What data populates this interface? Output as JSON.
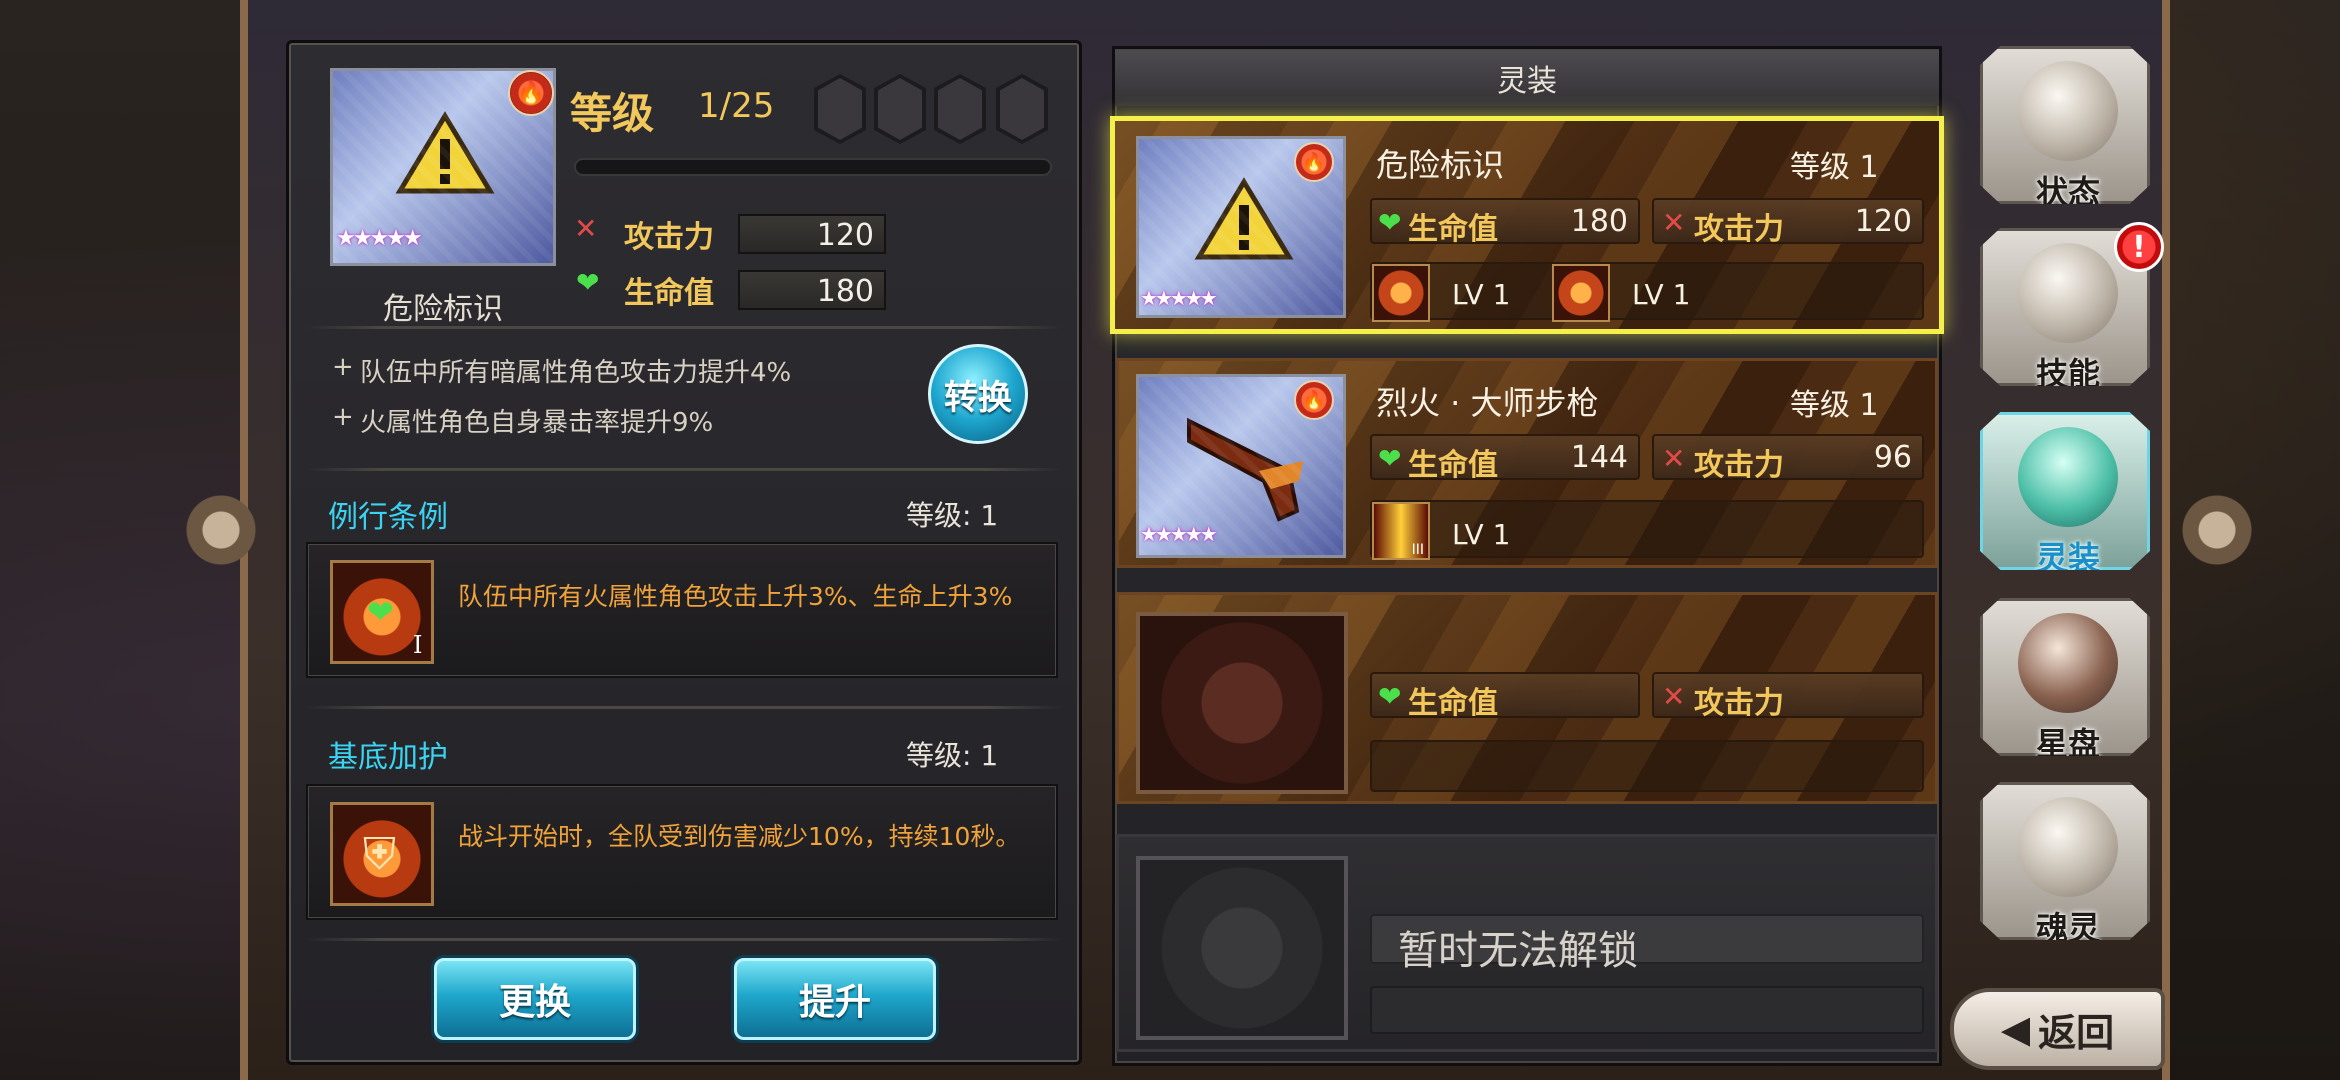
{
  "equipment": {
    "name": "危险标识",
    "level_label": "等级",
    "level_value": "1/25",
    "stats": [
      {
        "label": "攻击力",
        "value": "120",
        "icon": "crossed-swords-icon"
      },
      {
        "label": "生命值",
        "value": "180",
        "icon": "heart-icon"
      }
    ],
    "bonuses": [
      "队伍中所有暗属性角色攻击力提升4%",
      "火属性角色自身暴击率提升9%"
    ],
    "convert_button": "转换",
    "stars": "★★★★★"
  },
  "skills": [
    {
      "title": "例行条例",
      "level": "等级: 1",
      "description": "队伍中所有火属性角色攻击上升3%、生命上升3%",
      "roman": "I"
    },
    {
      "title": "基底加护",
      "level": "等级: 1",
      "description": "战斗开始时，全队受到伤害减少10%，持续10秒。"
    }
  ],
  "buttons": {
    "replace": "更换",
    "upgrade": "提升"
  },
  "center": {
    "title": "灵装",
    "slots": [
      {
        "name": "危险标识",
        "level": "等级 1",
        "hp_label": "生命值",
        "hp": "180",
        "atk_label": "攻击力",
        "atk": "120",
        "skill_levels": [
          "LV 1",
          "LV 1"
        ],
        "selected": true
      },
      {
        "name": "烈火 · 大师步枪",
        "level": "等级 1",
        "hp_label": "生命值",
        "hp": "144",
        "atk_label": "攻击力",
        "atk": "96",
        "skill_levels": [
          "LV 1"
        ],
        "roman": "III"
      },
      {
        "hp_label": "生命值",
        "atk_label": "攻击力"
      },
      {
        "locked_text": "暂时无法解锁"
      }
    ]
  },
  "nav": {
    "items": [
      {
        "label": "状态",
        "icon": "rose-icon"
      },
      {
        "label": "技能",
        "icon": "fleur-icon",
        "alert": "!"
      },
      {
        "label": "灵装",
        "icon": "crystal-icon",
        "active": true
      },
      {
        "label": "星盘",
        "icon": "orb-icon"
      },
      {
        "label": "魂灵",
        "icon": "book-icon"
      }
    ],
    "back": "返回"
  },
  "colors": {
    "accent_gold": "#f2c75b",
    "cyan": "#3ad3f2",
    "orange_desc": "#f0a33a",
    "selected_border": "#f5ef4a"
  }
}
